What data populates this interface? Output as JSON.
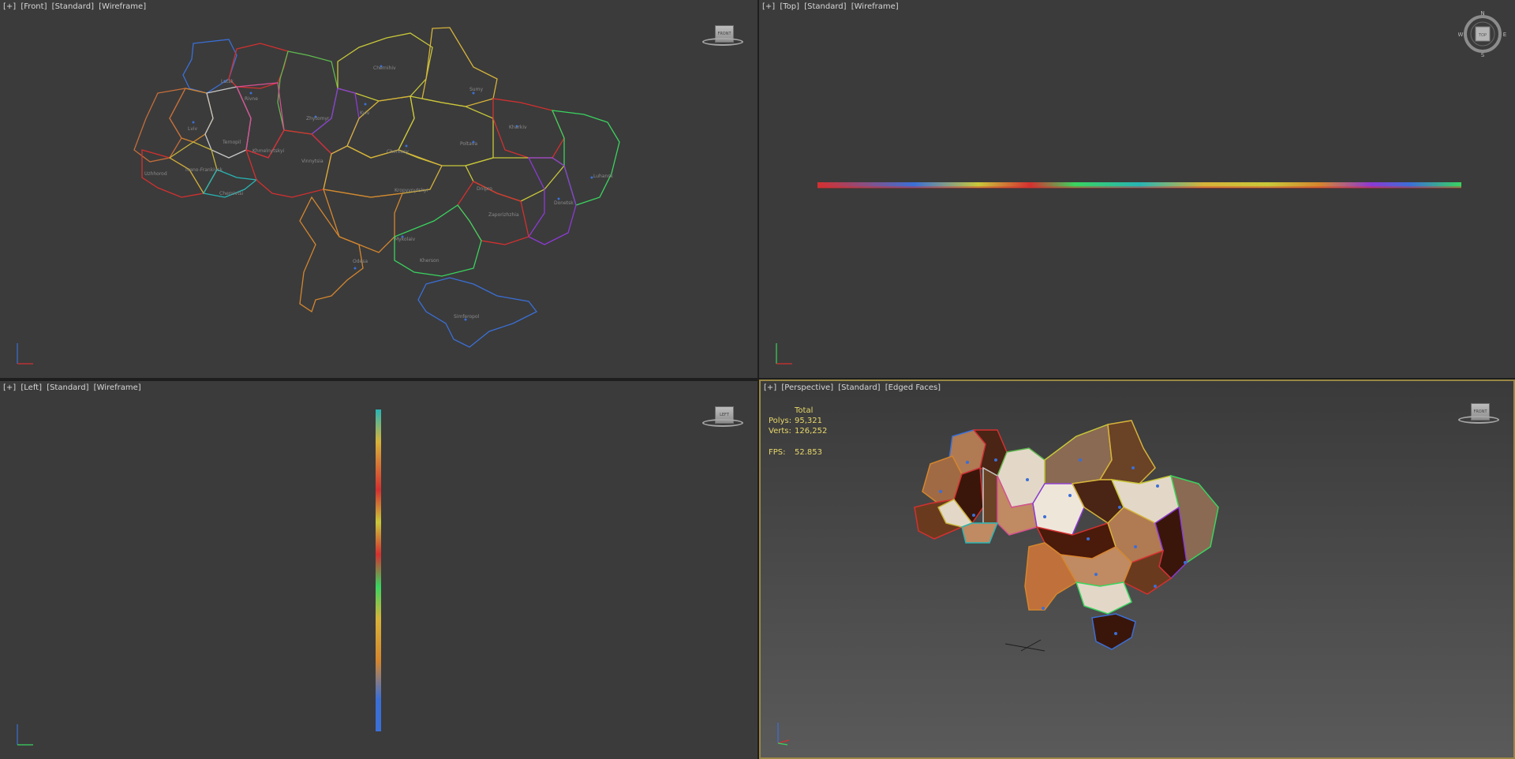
{
  "viewports": {
    "front": {
      "label": [
        "[+]",
        "[Front]",
        "[Standard]",
        "[Wireframe]"
      ],
      "cube": "FRONT"
    },
    "top": {
      "label": [
        "[+]",
        "[Top]",
        "[Standard]",
        "[Wireframe]"
      ],
      "compass": {
        "n": "N",
        "s": "S",
        "e": "E",
        "w": "W",
        "face": "TOP"
      }
    },
    "left": {
      "label": [
        "[+]",
        "[Left]",
        "[Standard]",
        "[Wireframe]"
      ],
      "cube": "LEFT"
    },
    "perspective": {
      "label": [
        "[+]",
        "[Perspective]",
        "[Standard]",
        "[Edged Faces]"
      ],
      "cube": "FRONT",
      "stats": {
        "header": "Total",
        "polys_label": "Polys:",
        "polys": "95,321",
        "verts_label": "Verts:",
        "verts": "126,252",
        "fps_label": "FPS:",
        "fps": "52.853"
      }
    }
  },
  "regions": [
    "Lutsk",
    "Rivne",
    "Zhytomyr",
    "Chernihiv",
    "Sumy",
    "Lviv",
    "Ternopil",
    "Khmelnytskyi",
    "Kyiv",
    "Kharkiv",
    "Uzhhorod",
    "Ivano-Frankivsk",
    "Chernivtsi",
    "Vinnytsia",
    "Cherkasy",
    "Poltava",
    "Luhansk",
    "Kropyvnytskyi",
    "Dnipro",
    "Donetsk",
    "Zaporizhzhia",
    "Mykolaiv",
    "Odesa",
    "Kherson",
    "Simferopol"
  ],
  "colors": {
    "viewport_bg": "#3b3b3b",
    "active_border": "#9a8744",
    "label": "#d6d6d6",
    "stats": "#e8d86a"
  }
}
